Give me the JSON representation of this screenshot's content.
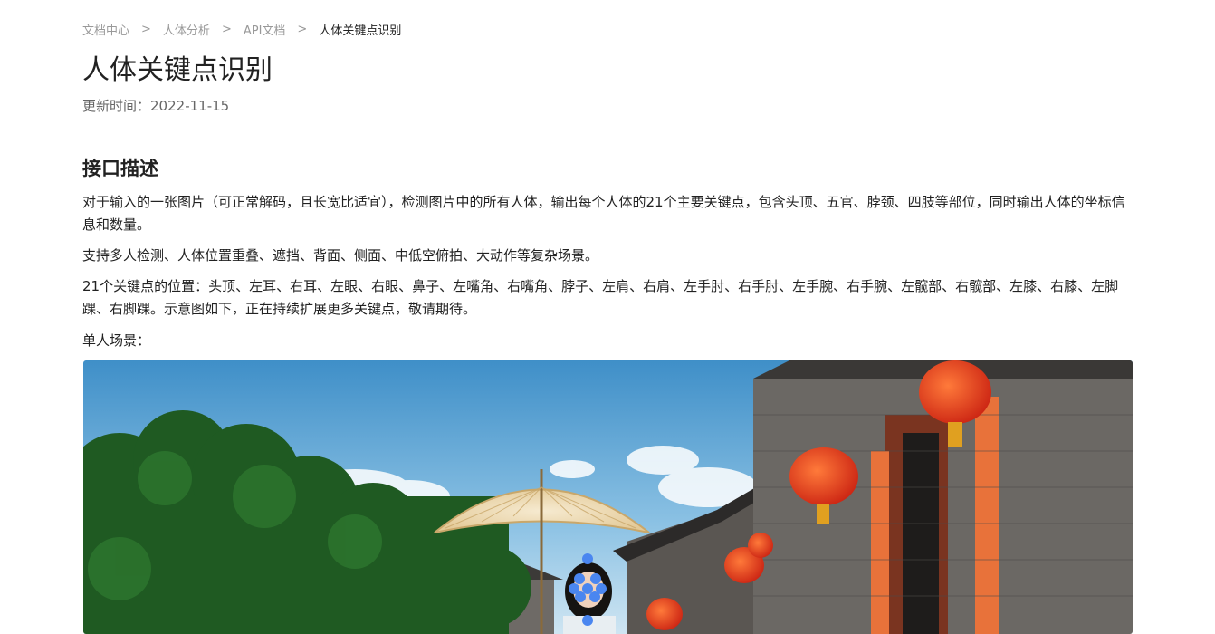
{
  "breadcrumb": {
    "items": [
      "文档中心",
      "人体分析",
      "API文档",
      "人体关键点识别"
    ],
    "separator": ">"
  },
  "title": "人体关键点识别",
  "update": {
    "label": "更新时间：",
    "date": "2022-11-15"
  },
  "section": {
    "title": "接口描述",
    "paragraphs": [
      "对于输入的一张图片（可正常解码，且长宽比适宜），检测图片中的所有人体，输出每个人体的21个主要关键点，包含头顶、五官、脖颈、四肢等部位，同时输出人体的坐标信息和数量。",
      "支持多人检测、人体位置重叠、遮挡、背面、侧面、中低空俯拍、大动作等复杂场景。",
      "21个关键点的位置：头顶、左耳、右耳、左眼、右眼、鼻子、左嘴角、右嘴角、脖子、左肩、右肩、左手肘、右手肘、左手腕、右手腕、左髋部、右髋部、左膝、右膝、左脚踝、右脚踝。示意图如下，正在持续扩展更多关键点，敬请期待。",
      "单人场景："
    ]
  },
  "image": {
    "subject": "woman with oil-paper umbrella beside old brick houses with red lanterns",
    "keypoint_color": "#4a86f0"
  }
}
